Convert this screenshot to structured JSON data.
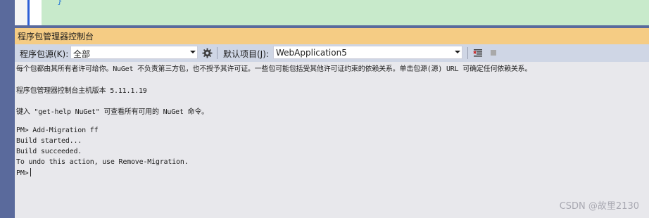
{
  "window": {
    "title": "程序包管理器控制台"
  },
  "toolbar": {
    "source_label": "程序包源(K):",
    "source_value": "全部",
    "project_label": "默认项目(J):",
    "project_value": "WebApplication5",
    "icons": [
      "gear-icon",
      "clear-console-icon",
      "stop-icon"
    ]
  },
  "console": {
    "lines": [
      "每个包都由其所有者许可给你。NuGet 不负责第三方包，也不授予其许可证。一些包可能包括受其他许可证约束的依赖关系。单击包源(源) URL 可确定任何依赖关系。",
      "程序包管理器控制台主机版本 5.11.1.19",
      "键入 \"get-help NuGet\" 可查看所有可用的 NuGet 命令。",
      "PM> Add-Migration ff",
      "Build started...",
      "Build succeeded.",
      "To undo this action, use Remove-Migration.",
      "PM>"
    ]
  },
  "watermark": "CSDN @故里2130"
}
